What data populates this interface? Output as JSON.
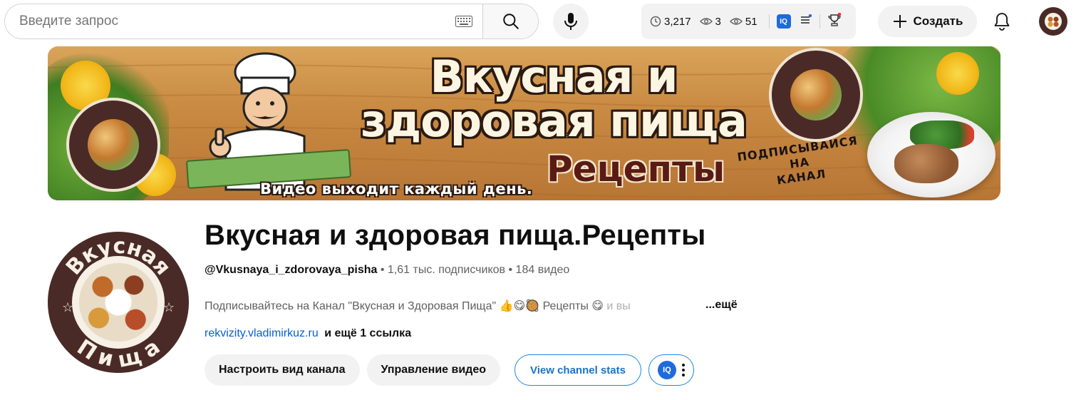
{
  "search": {
    "placeholder": "Введите запрос"
  },
  "toolbar": {
    "stats": {
      "watch_time": "3,217",
      "views_a": "3",
      "views_b": "51"
    },
    "create_label": "Создать"
  },
  "banner": {
    "title_line1": "Вкусная и",
    "title_line2": "здоровая пища",
    "subtitle": "Рецепты",
    "tagline": "Видео выходит каждый день.",
    "cta_line1": "ПОДПИСЫВАЙСЯ",
    "cta_line2": "НА",
    "cta_line3": "КАНАЛ",
    "logo_top": "Вкусная",
    "logo_bottom": "Пища"
  },
  "channel": {
    "name": "Вкусная и здоровая пища.Рецепты",
    "handle": "@Vkusnaya_i_zdorovaya_pisha",
    "separator": "•",
    "subscribers": "1,61 тыс. подписчиков",
    "videos": "184 видео",
    "description": "Подписывайтесь на Канал \"Вкусная и Здоровая Пища\" 👍😋🥘 Рецепты 😋",
    "description_faded": " и вы",
    "more_label": "...ещё",
    "link": "rekvizity.vladimirkuz.ru",
    "link_more": "и ещё 1 ссылка",
    "avatar_top": "Вкусная",
    "avatar_bottom": "Пища"
  },
  "actions": {
    "customize_label": "Настроить вид канала",
    "manage_label": "Управление видео",
    "stats_label": "View channel stats",
    "iq_badge": "IQ"
  },
  "icons": {
    "keyboard": "keyboard-icon",
    "search": "search-icon",
    "mic": "mic-icon",
    "clock": "clock-icon",
    "eye": "eye-icon",
    "menu": "menu-icon",
    "trophy": "trophy-icon",
    "plus": "plus-icon",
    "bell": "bell-icon",
    "kebab": "more-vert-icon"
  },
  "colors": {
    "link": "#065fd4",
    "accent": "#1e88e5",
    "brand_dark": "#4a2a26"
  }
}
